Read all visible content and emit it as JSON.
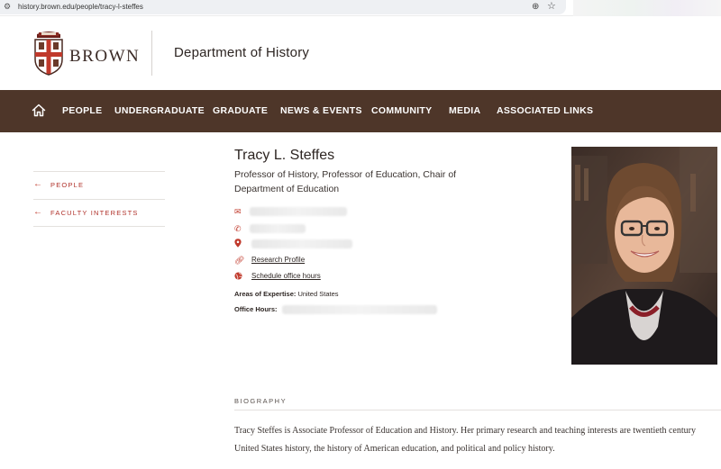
{
  "browser": {
    "url": "history.brown.edu/people/tracy-l-steffes",
    "icons": {
      "site_info": "tune-icon",
      "zoom": "zoom-icon",
      "bookmark": "star-icon"
    }
  },
  "header": {
    "logo_text": "BROWN",
    "department": "Department of History"
  },
  "nav": {
    "home_icon": "home-icon",
    "items": [
      "PEOPLE",
      "UNDERGRADUATE",
      "GRADUATE",
      "NEWS & EVENTS",
      "COMMUNITY",
      "MEDIA",
      "ASSOCIATED LINKS"
    ]
  },
  "sidebar": {
    "items": [
      {
        "label": "PEOPLE",
        "icon": "arrow-left-icon"
      },
      {
        "label": "FACULTY INTERESTS",
        "icon": "arrow-left-icon"
      }
    ]
  },
  "profile": {
    "name": "Tracy L. Steffes",
    "title": "Professor of History, Professor of Education, Chair of Department of Education",
    "contacts": {
      "email_icon": "envelope-icon",
      "phone_icon": "phone-icon",
      "location_icon": "map-pin-icon",
      "research_icon": "link-icon",
      "research_label": "Research Profile",
      "office_icon": "globe-icon",
      "office_label": "Schedule office hours"
    },
    "areas_label": "Areas of Expertise:",
    "areas_value": "United States",
    "office_hours_label": "Office Hours:"
  },
  "biography": {
    "heading": "BIOGRAPHY",
    "text": "Tracy Steffes is Associate Professor of Education and History. Her primary research and teaching interests are twentieth century United States history, the history of American education, and political and policy history."
  },
  "colors": {
    "nav_bg": "#4e3629",
    "accent_red": "#c0392b",
    "text_dark": "#2d2522"
  }
}
